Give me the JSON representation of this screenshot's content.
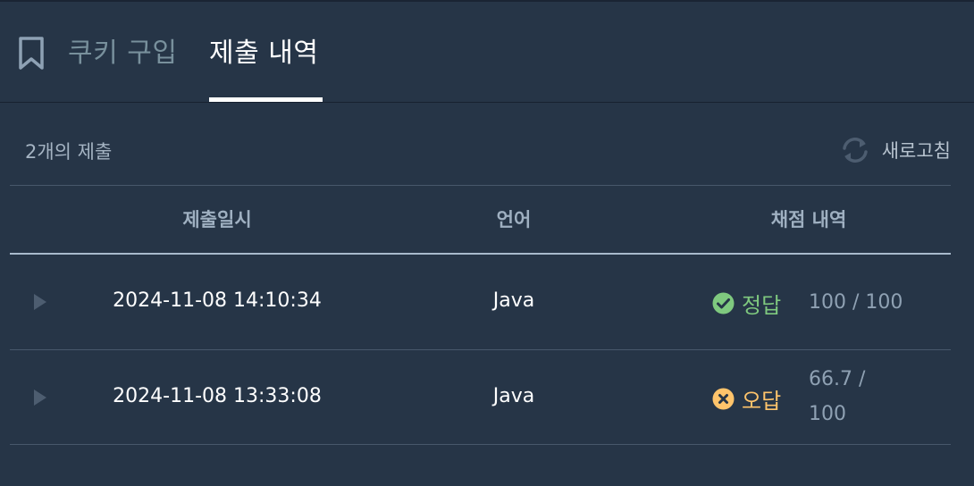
{
  "tabs": {
    "buy_label": "쿠키 구입",
    "history_label": "제출 내역"
  },
  "summary": {
    "count_text": "2개의 제출",
    "refresh_label": "새로고침"
  },
  "table": {
    "headers": [
      "제출일시",
      "언어",
      "채점 내역"
    ],
    "rows": [
      {
        "datetime": "2024-11-08 14:10:34",
        "language": "Java",
        "result": "정답",
        "result_status": "correct",
        "score_line1": "100 / 100",
        "score_line2": ""
      },
      {
        "datetime": "2024-11-08 13:33:08",
        "language": "Java",
        "result": "오답",
        "result_status": "wrong",
        "score_line1": "66.7 /",
        "score_line2": "100"
      }
    ]
  },
  "colors": {
    "background": "#263547",
    "correct": "#7fc97f",
    "wrong": "#ffc46b",
    "muted": "#8fa1b3"
  }
}
